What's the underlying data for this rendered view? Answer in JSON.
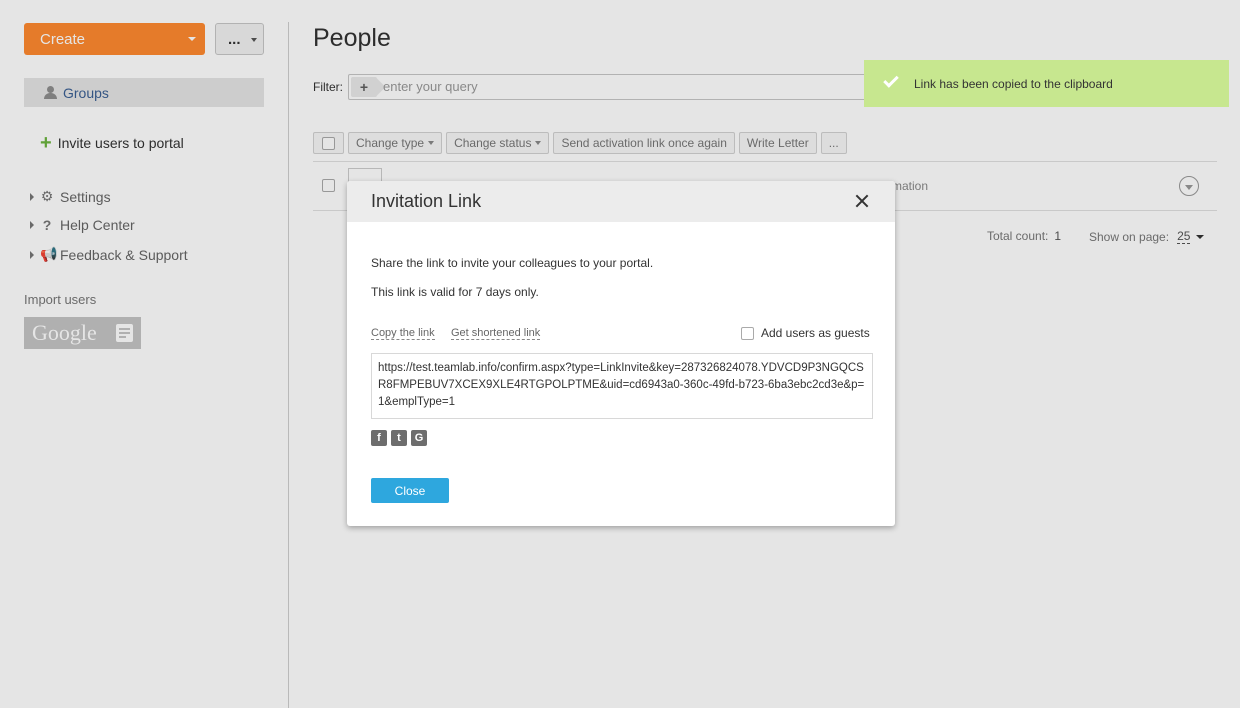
{
  "sidebar": {
    "create_label": "Create",
    "more_label": "...",
    "groups_label": "Groups",
    "invite_label": "Invite users to portal",
    "nav": [
      {
        "label": "Settings"
      },
      {
        "label": "Help Center"
      },
      {
        "label": "Feedback & Support"
      }
    ],
    "import_label": "Import users",
    "google_label": "Google"
  },
  "main": {
    "title": "People",
    "filter_label": "Filter:",
    "filter_placeholder": "enter your query",
    "toolbar": {
      "change_type": "Change type",
      "change_status": "Change status",
      "send_activation": "Send activation link once again",
      "write_letter": "Write Letter",
      "more": "..."
    },
    "row_info_text": "rmation",
    "total_count_label": "Total count:",
    "total_count_value": "1",
    "show_on_page_label": "Show on page:",
    "show_on_page_value": "25"
  },
  "toast": {
    "message": "Link has been copied to the clipboard",
    "color": "#c7e78f"
  },
  "dialog": {
    "title": "Invitation Link",
    "text1": "Share the link to invite your colleagues to your portal.",
    "text2": "This link is valid for 7 days only.",
    "copy_link": "Copy the link",
    "shortened_link": "Get shortened link",
    "add_guests_label": "Add users as guests",
    "url": "https://test.teamlab.info/confirm.aspx?type=LinkInvite&key=287326824078.YDVCD9P3NGQCSR8FMPEBUV7XCEX9XLE4RTGPOLPTME&uid=cd6943a0-360c-49fd-b723-6ba3ebc2cd3e&p=1&emplType=1",
    "socials": [
      "facebook-icon",
      "twitter-icon",
      "google-icon"
    ],
    "close_label": "Close",
    "accent_color": "#2ea7de"
  },
  "colors": {
    "create_button": "#ff8a2f",
    "groups_link": "#3a5f93"
  }
}
